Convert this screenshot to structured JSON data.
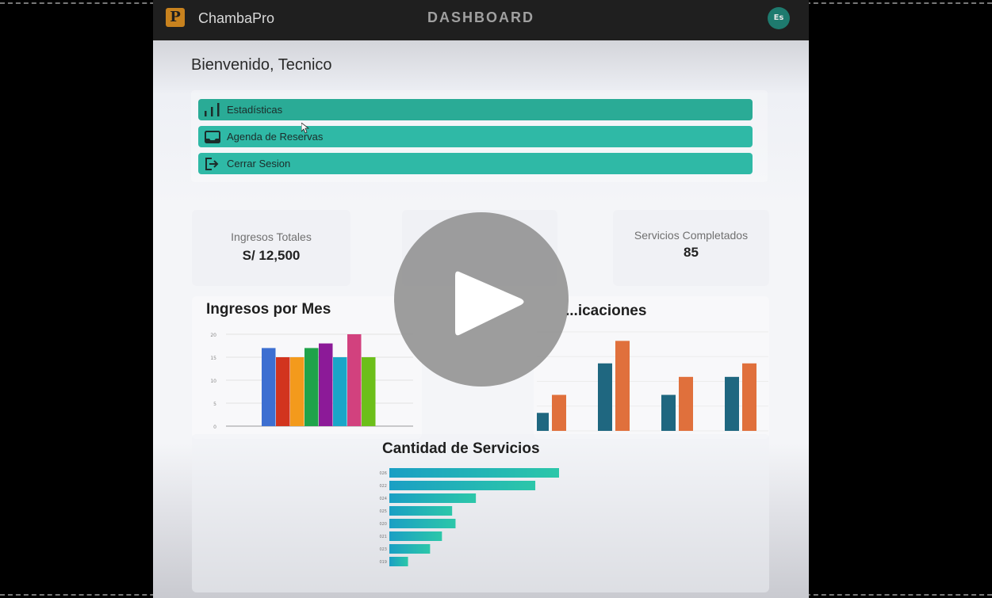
{
  "header": {
    "brand": "ChambaPro",
    "title": "DASHBOARD",
    "avatar_initials": "Es",
    "logo_letter": "P"
  },
  "welcome": "Bienvenido, Tecnico",
  "menu": [
    {
      "label": "Estadísticas",
      "icon": "bar-chart-icon"
    },
    {
      "label": "Agenda de Reservas",
      "icon": "inbox-icon"
    },
    {
      "label": "Cerrar Sesion",
      "icon": "logout-icon"
    }
  ],
  "stats": [
    {
      "label": "Ingresos Totales",
      "value": "S/ 12,500"
    },
    {
      "label": "Servicios Completados",
      "value": "85"
    }
  ],
  "colors": {
    "accent": "#2fb9a6",
    "header_bg": "#1f1f1f",
    "bar_blue": "#1f6780",
    "bar_orange": "#e0703c"
  },
  "chart_data": [
    {
      "type": "bar",
      "title": "Ingresos por Mes",
      "values": [
        17,
        15,
        15,
        17,
        18,
        15,
        20,
        15
      ],
      "colors": [
        "#3d6fd1",
        "#d2341e",
        "#f39a1c",
        "#1fa34a",
        "#8c1a98",
        "#1aa6c8",
        "#d2417e",
        "#6cbf1a"
      ],
      "yticks": [
        "0",
        "5",
        "10",
        "15",
        "20"
      ],
      "ylim": [
        0,
        20
      ]
    },
    {
      "type": "bar",
      "title": "...icaciones",
      "series": [
        {
          "values": [
            4,
            15,
            8,
            12
          ]
        },
        {
          "values": [
            8,
            20,
            12,
            15
          ]
        }
      ],
      "ylim": [
        0,
        22
      ]
    },
    {
      "type": "bar",
      "orientation": "horizontal",
      "title": "Cantidad de Servicios",
      "categories": [
        "2026",
        "2022",
        "2024",
        "2025",
        "2020",
        "2021",
        "2023",
        "2019"
      ],
      "values": [
        100,
        86,
        51,
        37,
        39,
        31,
        24,
        11
      ]
    }
  ],
  "play_label": "play"
}
